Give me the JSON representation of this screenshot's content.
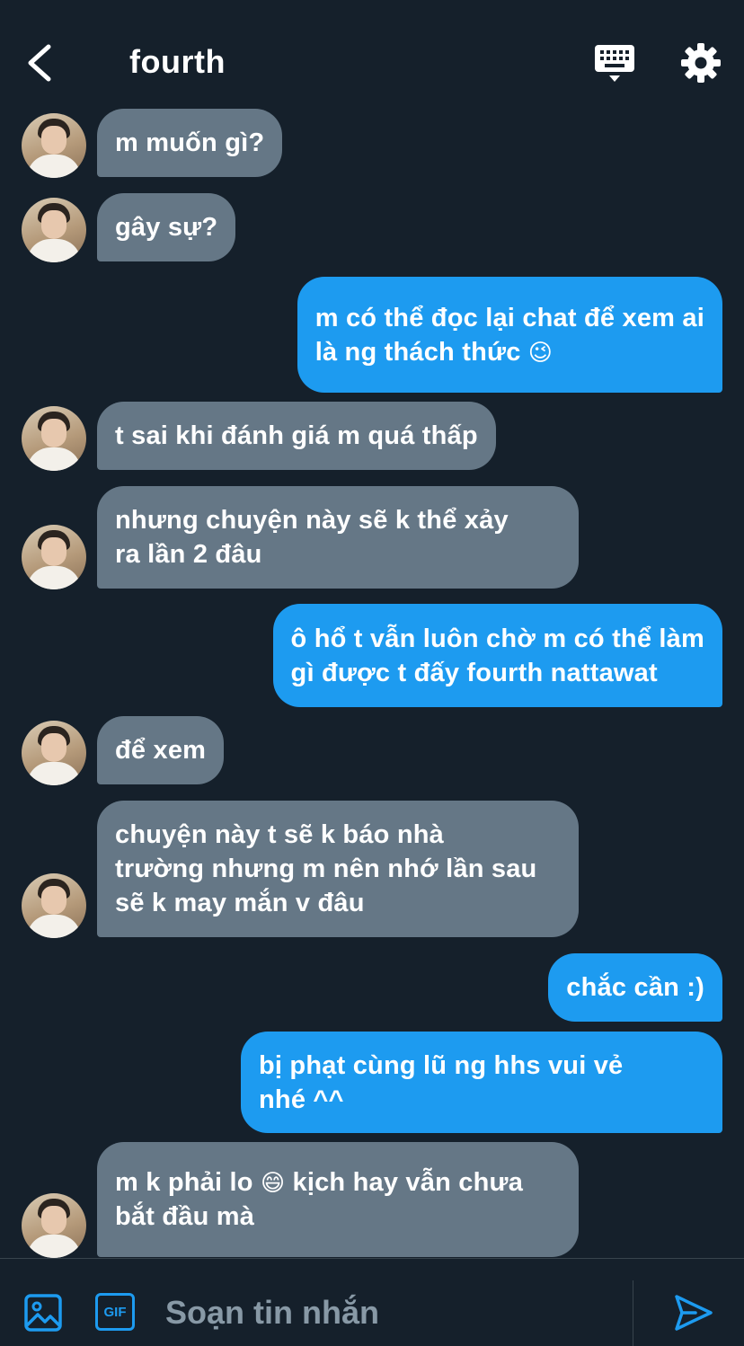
{
  "header": {
    "back_icon": "chevron-left-icon",
    "title": "fourth",
    "keyboard_icon": "keyboard-icon",
    "settings_icon": "gear-icon"
  },
  "messages": [
    {
      "direction": "in",
      "text": "m muốn gì?"
    },
    {
      "direction": "in",
      "text": "gây sự?"
    },
    {
      "direction": "out",
      "text": "m có thể đọc lại chat để xem ai\nlà ng thách thức",
      "emoji": "😉"
    },
    {
      "direction": "in",
      "text": "t sai khi đánh giá m quá thấp"
    },
    {
      "direction": "in",
      "text": "nhưng chuyện này sẽ k thể xảy\nra lần 2 đâu"
    },
    {
      "direction": "out",
      "text": "ô hổ t vẫn luôn chờ m có thể làm\ngì được t đấy fourth nattawat"
    },
    {
      "direction": "in",
      "text": "để xem"
    },
    {
      "direction": "in",
      "text": "chuyện này t sẽ k báo nhà\ntrường nhưng m nên nhớ lần sau\nsẽ k may mắn v đâu"
    },
    {
      "direction": "out",
      "text": "chắc cần :)"
    },
    {
      "direction": "out",
      "text": "bị phạt cùng lũ ng hhs vui vẻ\nnhé ^^"
    },
    {
      "direction": "in",
      "text_before": "m k phải lo",
      "emoji": "😄",
      "text_after": " kịch hay vẫn chưa\nbắt đầu mà"
    }
  ],
  "composer": {
    "image_icon": "image-icon",
    "gif_label": "GIF",
    "placeholder": "Soạn tin nhắn",
    "value": "",
    "send_icon": "send-icon"
  },
  "colors": {
    "background": "#15202b",
    "incoming_bubble": "#657786",
    "outgoing_bubble": "#1d9bf0",
    "accent": "#1d9bf0"
  }
}
